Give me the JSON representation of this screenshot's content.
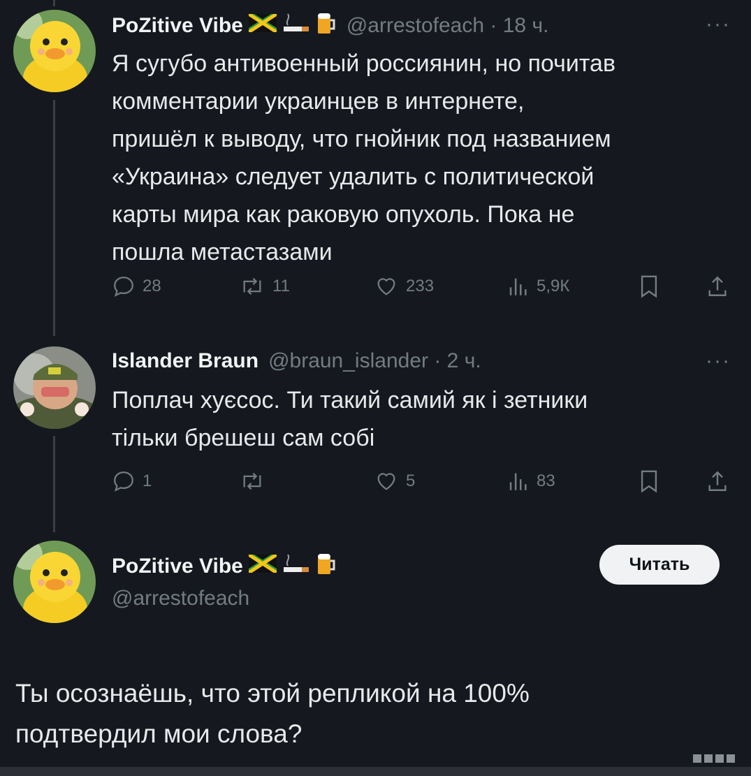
{
  "tweets": [
    {
      "name": "PoZitive Vibe",
      "handle": "@arrestofeach",
      "time": "18 ч.",
      "more": "···",
      "text_lines": [
        "Я сугубо антивоенный россиянин, но почитав",
        "комментарии украинцев в интернете,",
        "пришёл к выводу, что гнойник под названием",
        "«Украина» следует удалить с политической",
        "карты мира как раковую опухоль. Пока не",
        "пошла метастазами"
      ],
      "stats": {
        "replies": "28",
        "reposts": "11",
        "likes": "233",
        "views": "5,9К"
      }
    },
    {
      "name": "Islander Braun",
      "handle": "@braun_islander",
      "time": "2 ч.",
      "more": "···",
      "text_lines": [
        "Поплач хуєсос. Ти такий самий як і зетники",
        "тільки брешеш сам собі"
      ],
      "stats": {
        "replies": "1",
        "reposts": "",
        "likes": "5",
        "views": "83"
      }
    }
  ],
  "focused": {
    "name": "PoZitive Vibe",
    "handle": "@arrestofeach",
    "follow_label": "Читать",
    "text_lines": [
      "Ты осознаёшь, что этой репликой на 100%",
      "подтвердил мои слова?"
    ]
  },
  "icons": {
    "name_emojis": [
      "jamaica-flag-icon",
      "cigarette-icon",
      "beer-mug-icon"
    ],
    "actions": [
      "reply-icon",
      "repost-icon",
      "like-icon",
      "views-icon",
      "bookmark-icon",
      "share-icon"
    ]
  },
  "colors": {
    "background": "#15191f",
    "text": "#e7e9ea",
    "muted": "#737b84",
    "button_bg": "#f0f2f3"
  }
}
